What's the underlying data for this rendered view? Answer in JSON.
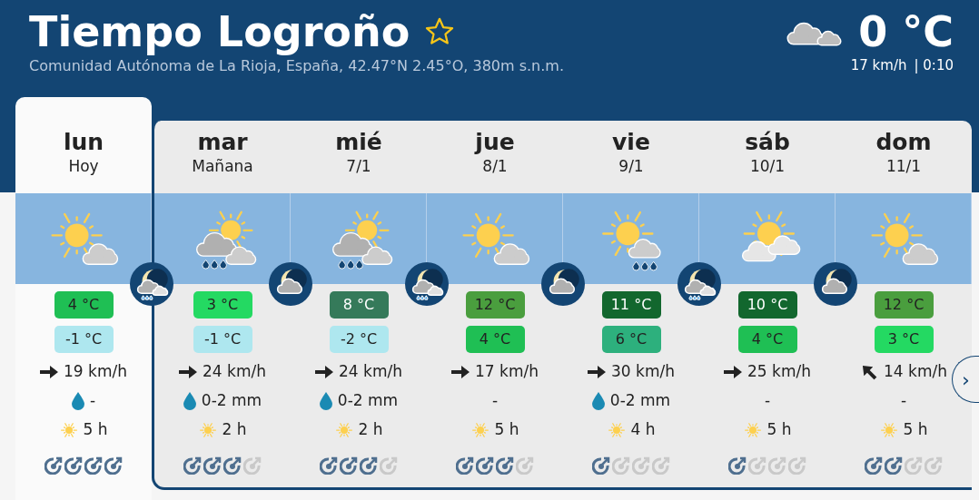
{
  "header": {
    "title": "Tiempo Logroño",
    "subtitle": "Comunidad Autónoma de La Rioja, España, 42.47°N 2.45°O, 380m s.n.m.",
    "current_temp": "0 °C",
    "current_wind": "17 km/h",
    "current_time": "| 0:10"
  },
  "days": [
    {
      "name": "lun",
      "date": "Hoy",
      "selected": true,
      "sky": {
        "kind": "sun_cloud"
      },
      "night": {
        "kind": "moon_cloud_rain"
      },
      "max": {
        "text": "4 °C",
        "color": "#1fbf54"
      },
      "min": {
        "text": "-1 °C",
        "color": "#aee7ef"
      },
      "wind": "19 km/h",
      "wind_arrow": {
        "kind": "east"
      },
      "precip": "-",
      "drop": true,
      "sun": "5 h",
      "stars": 4
    },
    {
      "name": "mar",
      "date": "Mañana",
      "selected": false,
      "sky": {
        "kind": "rain_cloud_sun"
      },
      "night": {
        "kind": "moon_cloud"
      },
      "max": {
        "text": "3 °C",
        "color": "#24d962"
      },
      "min": {
        "text": "-1 °C",
        "color": "#aee7ef"
      },
      "wind": "24 km/h",
      "wind_arrow": {
        "kind": "east"
      },
      "precip": "0-2 mm",
      "drop": true,
      "sun": "2 h",
      "stars": 3
    },
    {
      "name": "mié",
      "date": "7/1",
      "selected": false,
      "sky": {
        "kind": "rain_cloud_sun"
      },
      "night": {
        "kind": "moon_cloud_rain"
      },
      "max": {
        "text": "8 °C",
        "color": "#357a5a"
      },
      "min": {
        "text": "-2 °C",
        "color": "#aee7ef"
      },
      "wind": "24 km/h",
      "wind_arrow": {
        "kind": "east"
      },
      "precip": "0-2 mm",
      "drop": true,
      "sun": "2 h",
      "stars": 3
    },
    {
      "name": "jue",
      "date": "8/1",
      "selected": false,
      "sky": {
        "kind": "sun_cloud"
      },
      "night": {
        "kind": "moon_cloud"
      },
      "max": {
        "text": "12 °C",
        "color": "#4a9e3e"
      },
      "min": {
        "text": "4 °C",
        "color": "#1fbf54"
      },
      "wind": "17 km/h",
      "wind_arrow": {
        "kind": "east"
      },
      "precip": "-",
      "drop": false,
      "sun": "5 h",
      "stars": 3
    },
    {
      "name": "vie",
      "date": "9/1",
      "selected": false,
      "sky": {
        "kind": "sun_rain"
      },
      "night": {
        "kind": "moon_cloud_rain"
      },
      "max": {
        "text": "11 °C",
        "color": "#12672e"
      },
      "min": {
        "text": "6 °C",
        "color": "#2db07d"
      },
      "wind": "30 km/h",
      "wind_arrow": {
        "kind": "east"
      },
      "precip": "0-2 mm",
      "drop": true,
      "sun": "4 h",
      "stars": 1
    },
    {
      "name": "sáb",
      "date": "10/1",
      "selected": false,
      "sky": {
        "kind": "sun_clouds"
      },
      "night": {
        "kind": "moon_cloud"
      },
      "max": {
        "text": "10 °C",
        "color": "#12672e"
      },
      "min": {
        "text": "4 °C",
        "color": "#1fbf54"
      },
      "wind": "25 km/h",
      "wind_arrow": {
        "kind": "east"
      },
      "precip": "-",
      "drop": false,
      "sun": "5 h",
      "stars": 1
    },
    {
      "name": "dom",
      "date": "11/1",
      "selected": false,
      "sky": {
        "kind": "sun_cloud"
      },
      "max": {
        "text": "12 °C",
        "color": "#4a9e3e"
      },
      "min": {
        "text": "3 °C",
        "color": "#24d962"
      },
      "wind": "14 km/h",
      "wind_arrow": {
        "kind": "northwest"
      },
      "precip": "-",
      "drop": false,
      "sun": "5 h",
      "stars": 2
    }
  ],
  "next_button": "›"
}
